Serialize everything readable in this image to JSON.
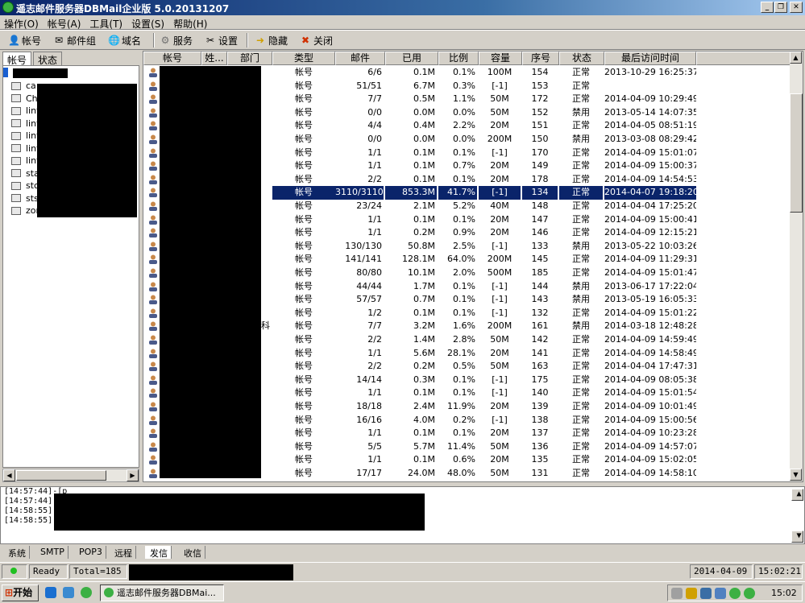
{
  "window": {
    "title": "遥志邮件服务器DBMail企业版 5.0.20131207"
  },
  "menu": [
    "操作(O)",
    "帐号(A)",
    "工具(T)",
    "设置(S)",
    "帮助(H)"
  ],
  "toolbar": {
    "account": "帐号",
    "mailgroup": "邮件组",
    "domain": "域名",
    "service": "服务",
    "settings": "设置",
    "hide": "隐藏",
    "close": "关闭"
  },
  "left_tabs": [
    "帐号",
    "状态"
  ],
  "tree": [
    "ca",
    "Ch",
    "lint",
    "lint",
    "lint",
    "lint",
    "lint",
    "sta",
    "stc",
    "sts",
    "zor"
  ],
  "columns": [
    "帐号",
    "姓...",
    "部门",
    "类型",
    "邮件",
    "已用",
    "比例",
    "容量",
    "序号",
    "状态",
    "最后访问时间"
  ],
  "rows": [
    [
      "帐号",
      "6/6",
      "0.1M",
      "0.1%",
      "100M",
      "154",
      "正常",
      "2013-10-29 16:25:37"
    ],
    [
      "帐号",
      "51/51",
      "6.7M",
      "0.3%",
      "[-1]",
      "153",
      "正常",
      ""
    ],
    [
      "帐号",
      "7/7",
      "0.5M",
      "1.1%",
      "50M",
      "172",
      "正常",
      "2014-04-09 10:29:49"
    ],
    [
      "帐号",
      "0/0",
      "0.0M",
      "0.0%",
      "50M",
      "152",
      "禁用",
      "2013-05-14 14:07:35"
    ],
    [
      "帐号",
      "4/4",
      "0.4M",
      "2.2%",
      "20M",
      "151",
      "正常",
      "2014-04-05 08:51:19"
    ],
    [
      "帐号",
      "0/0",
      "0.0M",
      "0.0%",
      "200M",
      "150",
      "禁用",
      "2013-03-08 08:29:42"
    ],
    [
      "帐号",
      "1/1",
      "0.1M",
      "0.1%",
      "[-1]",
      "170",
      "正常",
      "2014-04-09 15:01:07"
    ],
    [
      "帐号",
      "1/1",
      "0.1M",
      "0.7%",
      "20M",
      "149",
      "正常",
      "2014-04-09 15:00:37"
    ],
    [
      "帐号",
      "2/2",
      "0.1M",
      "0.1%",
      "20M",
      "178",
      "正常",
      "2014-04-09 14:54:53"
    ],
    [
      "帐号",
      "3110/3110",
      "853.3M",
      "41.7%",
      "[-1]",
      "134",
      "正常",
      "2014-04-07 19:18:20"
    ],
    [
      "帐号",
      "23/24",
      "2.1M",
      "5.2%",
      "40M",
      "148",
      "正常",
      "2014-04-04 17:25:20"
    ],
    [
      "帐号",
      "1/1",
      "0.1M",
      "0.1%",
      "20M",
      "147",
      "正常",
      "2014-04-09 15:00:41"
    ],
    [
      "帐号",
      "1/1",
      "0.2M",
      "0.9%",
      "20M",
      "146",
      "正常",
      "2014-04-09 12:15:21"
    ],
    [
      "帐号",
      "130/130",
      "50.8M",
      "2.5%",
      "[-1]",
      "133",
      "禁用",
      "2013-05-22 10:03:26"
    ],
    [
      "帐号",
      "141/141",
      "128.1M",
      "64.0%",
      "200M",
      "145",
      "正常",
      "2014-04-09 11:29:31"
    ],
    [
      "帐号",
      "80/80",
      "10.1M",
      "2.0%",
      "500M",
      "185",
      "正常",
      "2014-04-09 15:01:47"
    ],
    [
      "帐号",
      "44/44",
      "1.7M",
      "0.1%",
      "[-1]",
      "144",
      "禁用",
      "2013-06-17 17:22:04"
    ],
    [
      "帐号",
      "57/57",
      "0.7M",
      "0.1%",
      "[-1]",
      "143",
      "禁用",
      "2013-05-19 16:05:33"
    ],
    [
      "帐号",
      "1/2",
      "0.1M",
      "0.1%",
      "[-1]",
      "132",
      "正常",
      "2014-04-09 15:01:22"
    ],
    [
      "帐号",
      "7/7",
      "3.2M",
      "1.6%",
      "200M",
      "161",
      "禁用",
      "2014-03-18 12:48:28"
    ],
    [
      "帐号",
      "2/2",
      "1.4M",
      "2.8%",
      "50M",
      "142",
      "正常",
      "2014-04-09 14:59:49"
    ],
    [
      "帐号",
      "1/1",
      "5.6M",
      "28.1%",
      "20M",
      "141",
      "正常",
      "2014-04-09 14:58:49"
    ],
    [
      "帐号",
      "2/2",
      "0.2M",
      "0.5%",
      "50M",
      "163",
      "正常",
      "2014-04-04 17:47:31"
    ],
    [
      "帐号",
      "14/14",
      "0.3M",
      "0.1%",
      "[-1]",
      "175",
      "正常",
      "2014-04-09 08:05:38"
    ],
    [
      "帐号",
      "1/1",
      "0.1M",
      "0.1%",
      "[-1]",
      "140",
      "正常",
      "2014-04-09 15:01:54"
    ],
    [
      "帐号",
      "18/18",
      "2.4M",
      "11.9%",
      "20M",
      "139",
      "正常",
      "2014-04-09 10:01:49"
    ],
    [
      "帐号",
      "16/16",
      "4.0M",
      "0.2%",
      "[-1]",
      "138",
      "正常",
      "2014-04-09 15:00:56"
    ],
    [
      "帐号",
      "1/1",
      "0.1M",
      "0.1%",
      "20M",
      "137",
      "正常",
      "2014-04-09 10:23:28"
    ],
    [
      "帐号",
      "5/5",
      "5.7M",
      "11.4%",
      "50M",
      "136",
      "正常",
      "2014-04-09 14:57:07"
    ],
    [
      "帐号",
      "1/1",
      "0.1M",
      "0.6%",
      "20M",
      "135",
      "正常",
      "2014-04-09 15:02:05"
    ],
    [
      "帐号",
      "17/17",
      "24.0M",
      "48.0%",
      "50M",
      "131",
      "正常",
      "2014-04-09 14:58:10"
    ]
  ],
  "row_dept_fragment": "科",
  "log": [
    "[14:57:44]-[p",
    "[14:57:44]-[p",
    "[14:58:55]-[s",
    "[14:58:55]-[s"
  ],
  "bottom_tabs": [
    "系统",
    "SMTP",
    "POP3",
    "远程",
    "发信",
    "收信"
  ],
  "status": {
    "ready": "Ready",
    "total": "Total=185",
    "date": "2014-04-09",
    "time": "15:02:21"
  },
  "taskbar": {
    "start": "开始",
    "task": "遥志邮件服务器DBMai...",
    "clock": "15:02"
  }
}
